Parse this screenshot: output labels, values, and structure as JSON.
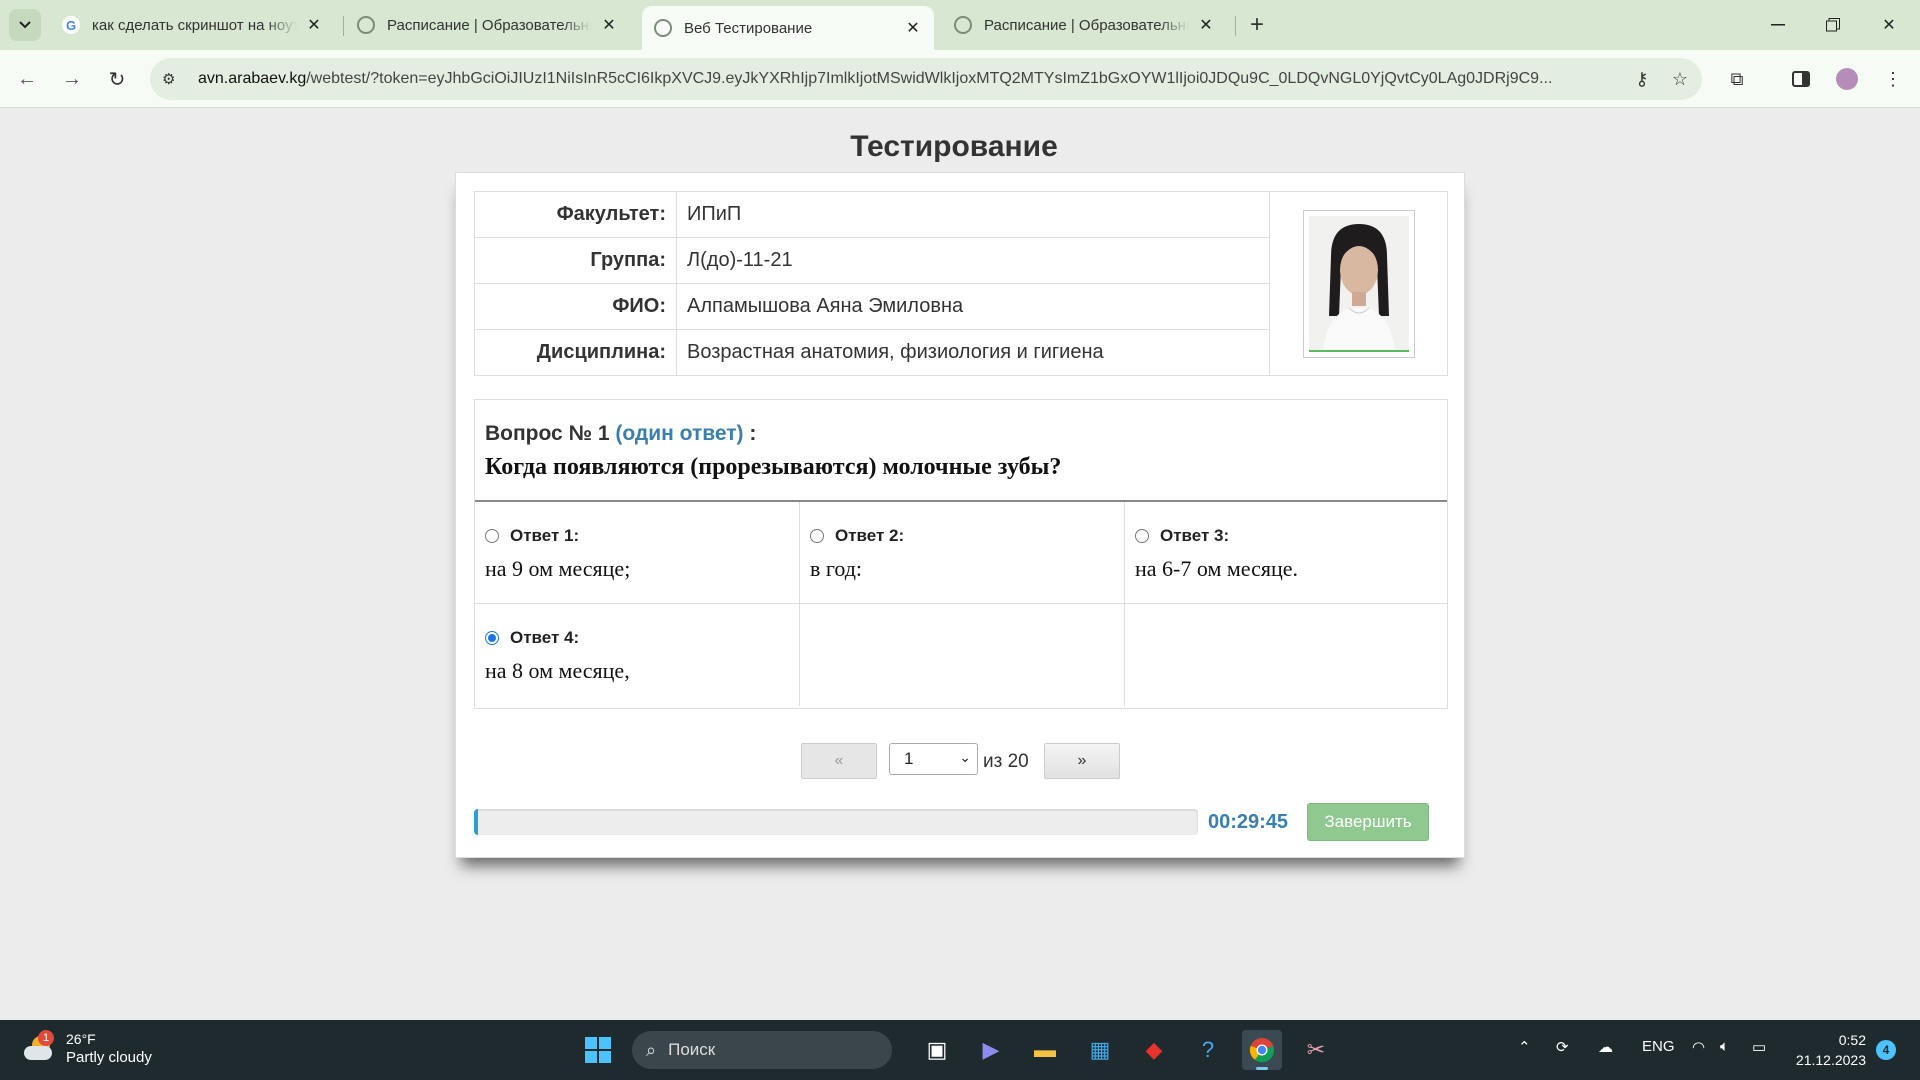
{
  "browser": {
    "tabs": [
      {
        "title": "как сделать скриншот на ноутбуке",
        "favicon": "google-icon",
        "active": false
      },
      {
        "title": "Расписание | Образовательный портал",
        "favicon": "globe-icon",
        "active": false
      },
      {
        "title": "Веб Тестирование",
        "favicon": "globe-icon",
        "active": true
      },
      {
        "title": "Расписание | Образовательный портал",
        "favicon": "globe-icon",
        "active": false
      }
    ],
    "url_host": "avn.arabaev.kg",
    "url_path": "/webtest/?token=eyJhbGciOiJIUzI1NiIsInR5cCI6IkpXVCJ9.eyJkYXRhIjp7ImlkIjotMSwidWlkIjoxMTQ2MTYsImZ1bGxOYW1lIjoi0JDQu9C_0LDQvNGL0YjQvtCy0LAg0JDRj9C9..."
  },
  "page": {
    "title": "Тестирование",
    "info": [
      {
        "label": "Факультет:",
        "value": "ИПиП"
      },
      {
        "label": "Группа:",
        "value": "Л(до)-11-21"
      },
      {
        "label": "ФИО:",
        "value": "Алпамышова Аяна Эмиловна"
      },
      {
        "label": "Дисциплина:",
        "value": "Возрастная анатомия, физиология и гигиена"
      }
    ],
    "question": {
      "number_label": "Вопрос № 1",
      "mode": "(один ответ)",
      "colon": ":",
      "text": "Когда появляются (прорезываются) молочные зубы?"
    },
    "answers": [
      {
        "label": "Ответ 1:",
        "text": "на 9 ом месяце;",
        "checked": false
      },
      {
        "label": "Ответ 2:",
        "text": "в год:",
        "checked": false
      },
      {
        "label": "Ответ 3:",
        "text": "на 6-7 ом месяце.",
        "checked": false
      },
      {
        "label": "Ответ 4:",
        "text": "на 8 ом месяце,",
        "checked": true
      }
    ],
    "pager": {
      "prev": "«",
      "next": "»",
      "current": "1",
      "of_label": "из 20"
    },
    "progress_fraction": 0.005,
    "timer": "00:29:45",
    "finish_label": "Завершить",
    "colors": {
      "accent": "#3a7fb0",
      "finish": "#8fc98f",
      "progress": "#2a9fd6"
    }
  },
  "taskbar": {
    "weather_badge": "1",
    "temperature": "26°F",
    "condition": "Partly cloudy",
    "search_placeholder": "Поиск",
    "language": "ENG",
    "time": "0:52",
    "date": "21.12.2023",
    "notifications": "4"
  }
}
